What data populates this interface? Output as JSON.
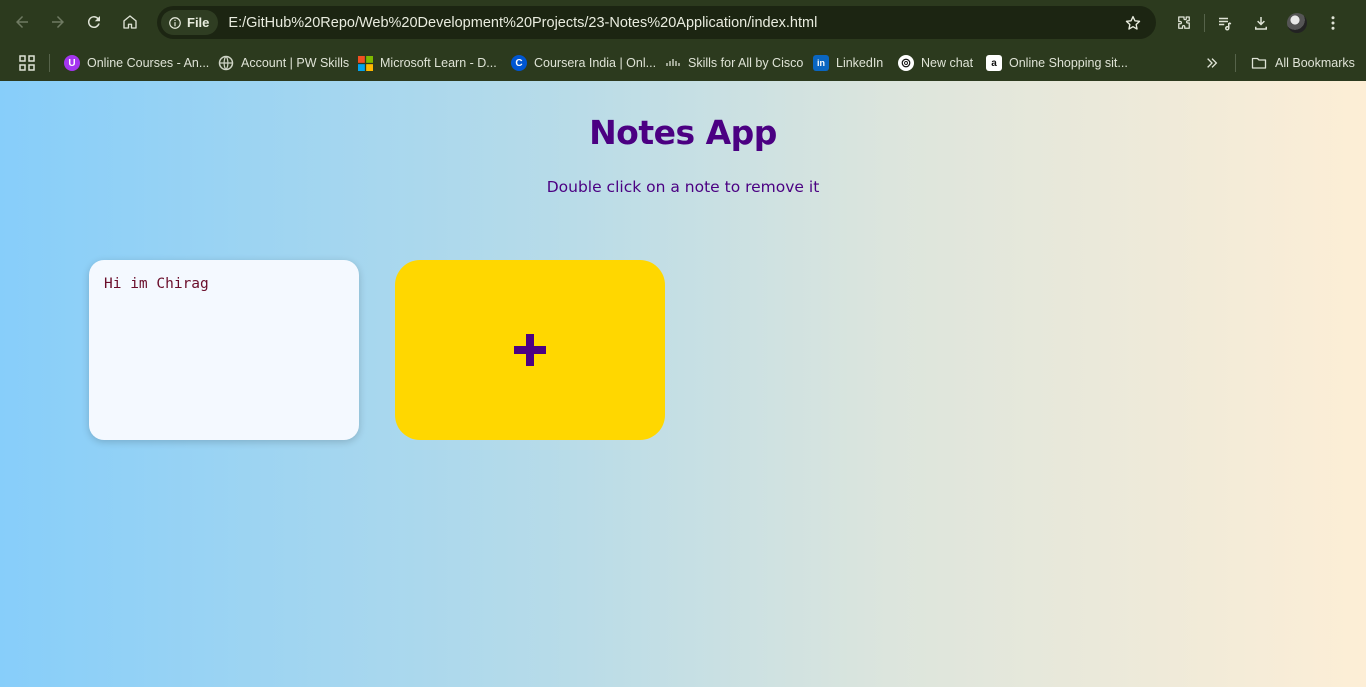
{
  "browser": {
    "site_chip_label": "File",
    "url": "E:/GitHub%20Repo/Web%20Development%20Projects/23-Notes%20Application/index.html",
    "icons": {
      "back": "arrow-left-icon",
      "forward": "arrow-right-icon",
      "reload": "reload-icon",
      "home": "home-icon",
      "info": "info-icon",
      "star": "star-icon",
      "extensions": "puzzle-icon",
      "media": "media-queue-icon",
      "downloads": "download-icon",
      "menu": "kebab-menu-icon"
    },
    "bookmarks": [
      {
        "label": "Online Courses - An...",
        "icon": "udemy-icon",
        "color": "#a435f0"
      },
      {
        "label": "Account | PW Skills",
        "icon": "globe-icon",
        "color": "#cfd4c6"
      },
      {
        "label": "Microsoft Learn - D...",
        "icon": "microsoft-icon",
        "color": "#f25022"
      },
      {
        "label": "Coursera India | Onl...",
        "icon": "coursera-icon",
        "color": "#0056d2"
      },
      {
        "label": "Skills for All by Cisco",
        "icon": "cisco-icon",
        "color": "#1ba0d7"
      },
      {
        "label": "LinkedIn",
        "icon": "linkedin-icon",
        "color": "#0a66c2"
      },
      {
        "label": "New chat",
        "icon": "openai-icon",
        "color": "#ffffff"
      },
      {
        "label": "Online Shopping sit...",
        "icon": "amazon-icon",
        "color": "#ff9900"
      }
    ],
    "all_bookmarks_label": "All Bookmarks"
  },
  "app": {
    "title": "Notes App",
    "subtitle": "Double click on a note to remove it",
    "notes": [
      {
        "text": "Hi im Chirag"
      }
    ],
    "add_button_icon": "plus-icon",
    "colors": {
      "title": "#4b0082",
      "note_bg": "#f4f9ff",
      "note_text": "#6a0d2a",
      "add_bg": "#ffd700",
      "plus": "#4b0082"
    }
  }
}
